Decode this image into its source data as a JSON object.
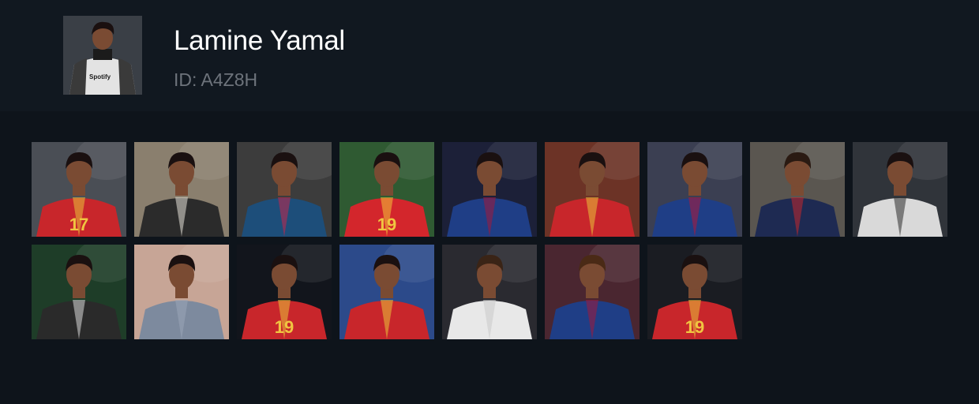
{
  "profile": {
    "name": "Lamine Yamal",
    "id_text": "ID: A4Z8H",
    "avatar_logo": "Spotify"
  },
  "photos": [
    {
      "bg": "#4a4e55",
      "skin": "#7a4b33",
      "hair": "#1a1010",
      "shirt": "#c8262b",
      "stripe": "#e9c23a",
      "number": "17",
      "numColor": "#f0c541"
    },
    {
      "bg": "#8a7f6e",
      "skin": "#7a4b33",
      "hair": "#1a1010",
      "shirt": "#2b2b2b",
      "stripe": "#e6e2d8",
      "number": "",
      "numColor": "#ffffff"
    },
    {
      "bg": "#3c3c3c",
      "skin": "#7a4b33",
      "hair": "#1a1010",
      "shirt": "#1d4e7a",
      "stripe": "#c4264d",
      "number": "",
      "numColor": "#ffffff"
    },
    {
      "bg": "#2f5a32",
      "skin": "#7a4b33",
      "hair": "#1a1010",
      "shirt": "#d3262c",
      "stripe": "#f2c43a",
      "number": "19",
      "numColor": "#f0c541"
    },
    {
      "bg": "#1c2038",
      "skin": "#7a4b33",
      "hair": "#1a1010",
      "shirt": "#1f3e86",
      "stripe": "#a3173a",
      "number": "",
      "numColor": "#ffffff"
    },
    {
      "bg": "#6c3326",
      "skin": "#7a4b33",
      "hair": "#1a1010",
      "shirt": "#c8262b",
      "stripe": "#e9c23a",
      "number": "",
      "numColor": "#ffffff"
    },
    {
      "bg": "#3b3f52",
      "skin": "#7a4b33",
      "hair": "#1a1010",
      "shirt": "#1f3e86",
      "stripe": "#b0173a",
      "number": "",
      "numColor": "#ffffff"
    },
    {
      "bg": "#5a5650",
      "skin": "#7a4b33",
      "hair": "#2a1a12",
      "shirt": "#1e2a52",
      "stripe": "#c4262b",
      "number": "",
      "numColor": "#ffffff"
    },
    {
      "bg": "#30343a",
      "skin": "#7a4b33",
      "hair": "#1a1010",
      "shirt": "#d9d9d9",
      "stripe": "#2b2b2b",
      "number": "",
      "numColor": "#ffffff"
    },
    {
      "bg": "#1e3d28",
      "skin": "#7a4b33",
      "hair": "#1a1010",
      "shirt": "#2a2a2a",
      "stripe": "#d8d8d8",
      "number": "",
      "numColor": "#ffffff"
    },
    {
      "bg": "#c7a596",
      "skin": "#7a4b33",
      "hair": "#1a1010",
      "shirt": "#7d8a9e",
      "stripe": "#9aa6b8",
      "number": "",
      "numColor": "#ffffff"
    },
    {
      "bg": "#12151c",
      "skin": "#7a4b33",
      "hair": "#1a1010",
      "shirt": "#c8262b",
      "stripe": "#e9c23a",
      "number": "19",
      "numColor": "#f0c541"
    },
    {
      "bg": "#2c4a8a",
      "skin": "#7a4b33",
      "hair": "#1a1010",
      "shirt": "#c8262b",
      "stripe": "#e9c23a",
      "number": "",
      "numColor": "#ffffff"
    },
    {
      "bg": "#2a2a30",
      "skin": "#7a4b33",
      "hair": "#3a2416",
      "shirt": "#e8e8e8",
      "stripe": "#c8c8c8",
      "number": "",
      "numColor": "#ffffff"
    },
    {
      "bg": "#4a2630",
      "skin": "#7a4b33",
      "hair": "#4a2a16",
      "shirt": "#1f3e86",
      "stripe": "#a3173a",
      "number": "",
      "numColor": "#ffffff"
    },
    {
      "bg": "#1a1c22",
      "skin": "#7a4b33",
      "hair": "#1a1010",
      "shirt": "#c8262b",
      "stripe": "#e9c23a",
      "number": "19",
      "numColor": "#f0c541"
    }
  ]
}
